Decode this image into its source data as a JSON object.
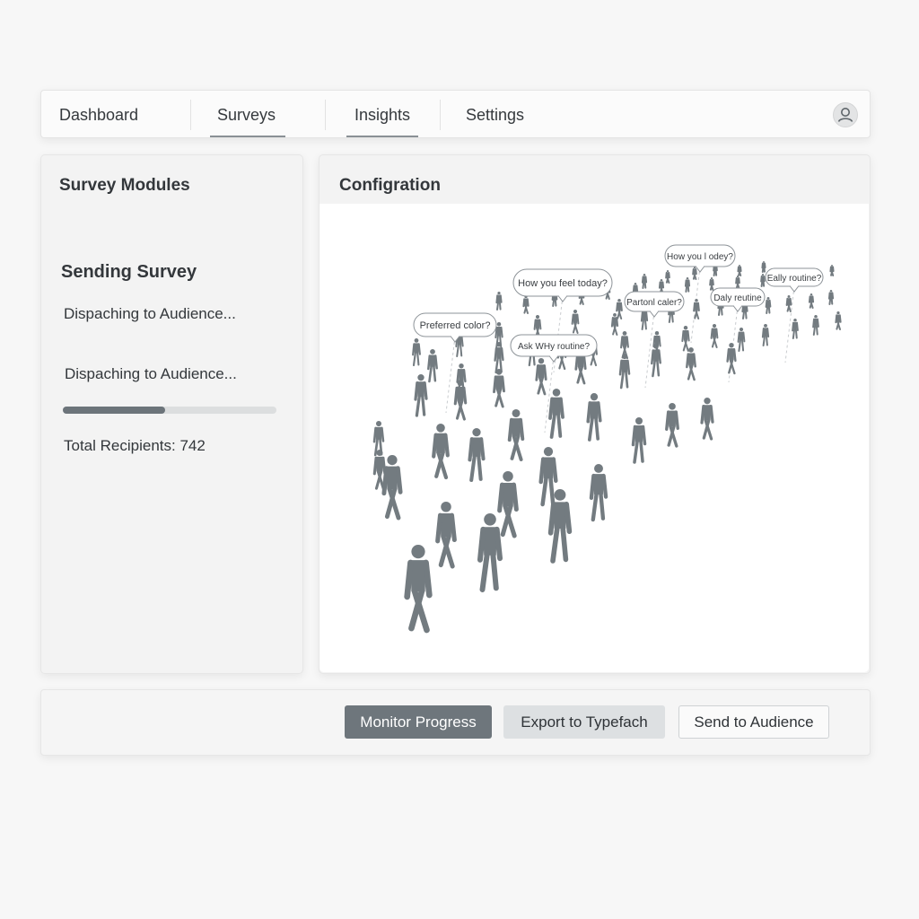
{
  "nav": {
    "tabs": [
      {
        "label": "Dashboard",
        "active": false
      },
      {
        "label": "Surveys",
        "active": true
      },
      {
        "label": "Insights",
        "active": true
      },
      {
        "label": "Settings",
        "active": false
      }
    ],
    "avatar_icon": "user-icon"
  },
  "modules_panel": {
    "title": "Survey Modules",
    "section_title": "Sending Survey",
    "status_line_1": "Dispaching to Audience...",
    "status_line_2": "Dispaching to Audience...",
    "progress": 0.48,
    "recipients_label": "Total Recipients: 742"
  },
  "config_panel": {
    "title": "Configration",
    "bubbles": [
      {
        "text": "How you feel today?"
      },
      {
        "text": "How you l odey?"
      },
      {
        "text": "Partonl caler?"
      },
      {
        "text": "Daly reutine"
      },
      {
        "text": "Eally routine?"
      },
      {
        "text": "Preferred color?"
      },
      {
        "text": "Ask WHy routine?"
      }
    ],
    "figure_color": "#737b80"
  },
  "actions": {
    "monitor_label": "Monitor Progress",
    "export_label": "Export to Typefach",
    "send_label": "Send to Audience"
  }
}
